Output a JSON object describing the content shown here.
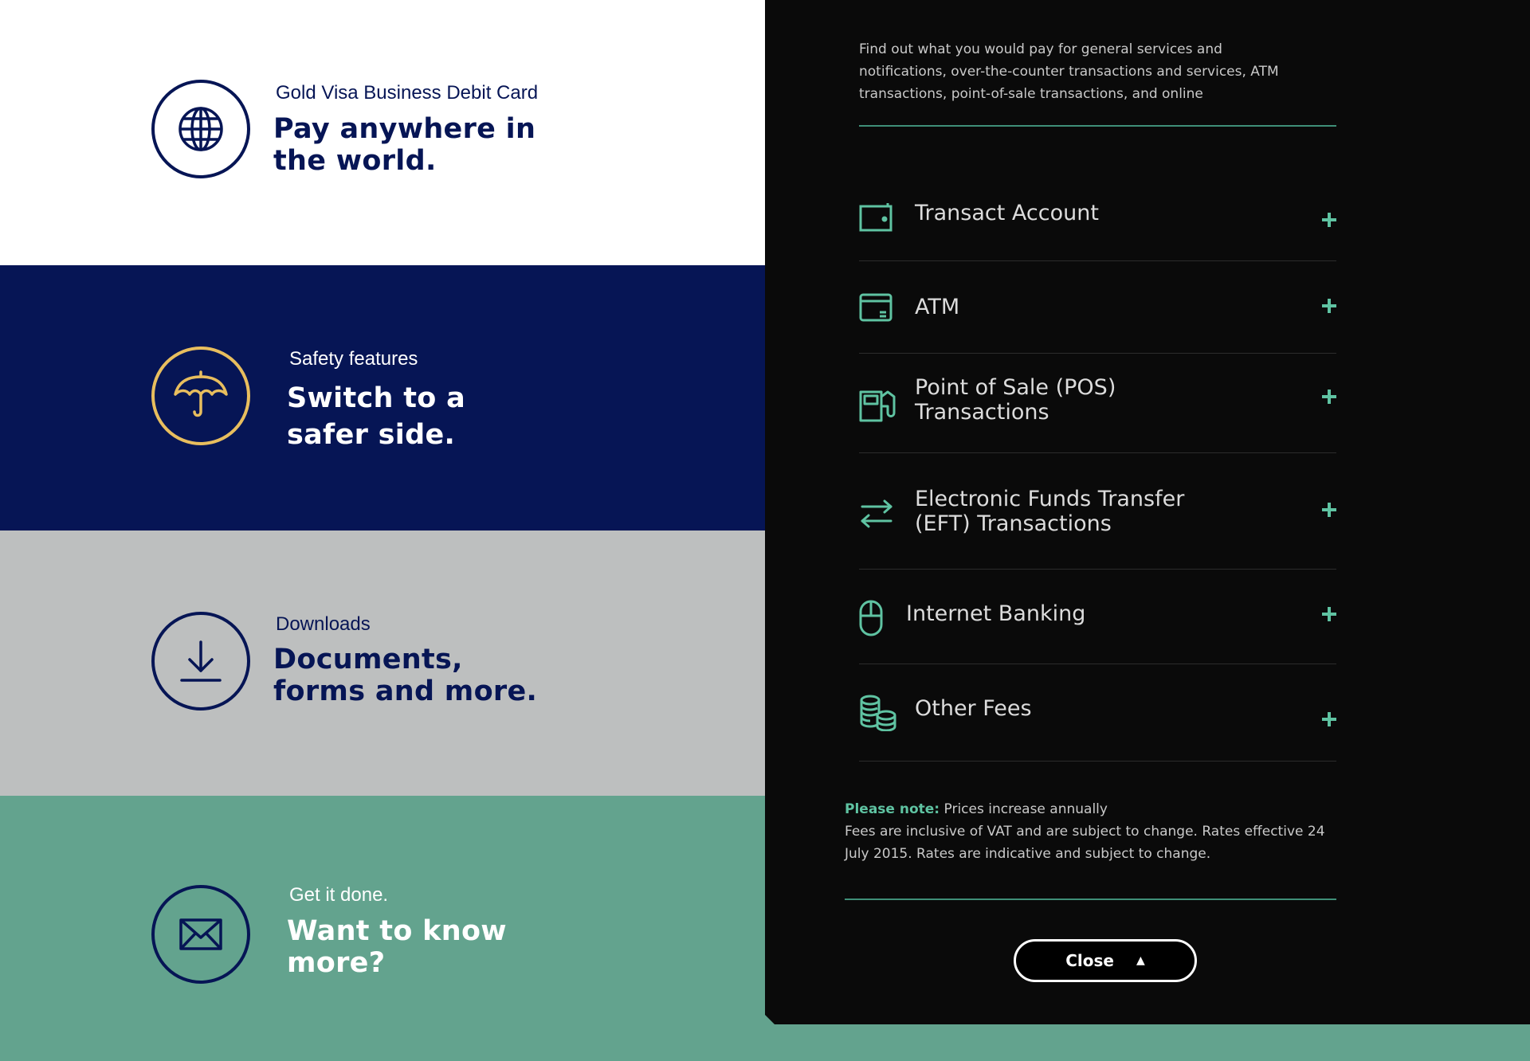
{
  "promos": [
    {
      "eyebrow": "Gold Visa Business Debit Card",
      "headline": "Pay anywhere in\nthe world.",
      "icon": "globe-icon",
      "bg": "#ffffff"
    },
    {
      "eyebrow": "Safety features",
      "headline": "Switch to a\nsafer side.",
      "icon": "umbrella-icon",
      "bg": "#061555"
    },
    {
      "eyebrow": "Downloads",
      "headline": "Documents,\nforms and more.",
      "icon": "download-icon",
      "bg": "#bdbfbf"
    },
    {
      "eyebrow": "Get it done.",
      "headline": "Want to know\nmore?",
      "icon": "envelope-icon",
      "bg": "#63a38e"
    }
  ],
  "fees": {
    "intro": "Find out what you would pay for general services and notifications, over-the-counter transactions and services, ATM transactions, point-of-sale transactions, and online",
    "items": [
      {
        "label": "Transact Account",
        "icon": "wallet-icon"
      },
      {
        "label": "ATM",
        "icon": "atm-card-icon"
      },
      {
        "label": "Point of Sale (POS)\nTransactions",
        "icon": "pos-terminal-icon"
      },
      {
        "label": "Electronic Funds Transfer\n(EFT) Transactions",
        "icon": "transfer-arrows-icon"
      },
      {
        "label": "Internet Banking",
        "icon": "mouse-icon"
      },
      {
        "label": "Other Fees",
        "icon": "coins-icon"
      }
    ],
    "note_label": "Please note:",
    "note_line1": " Prices increase annually",
    "note_line2": "Fees are inclusive of VAT and are subject to change. Rates effective 24 July 2015. Rates are indicative and subject to change.",
    "close_label": "Close",
    "close_glyph": "▲"
  },
  "colors": {
    "navy": "#061555",
    "gold": "#e8be5e",
    "teal": "#5fc3a2",
    "green": "#63a38e",
    "grey": "#bdbfbf",
    "panel": "#0a0a0a"
  }
}
